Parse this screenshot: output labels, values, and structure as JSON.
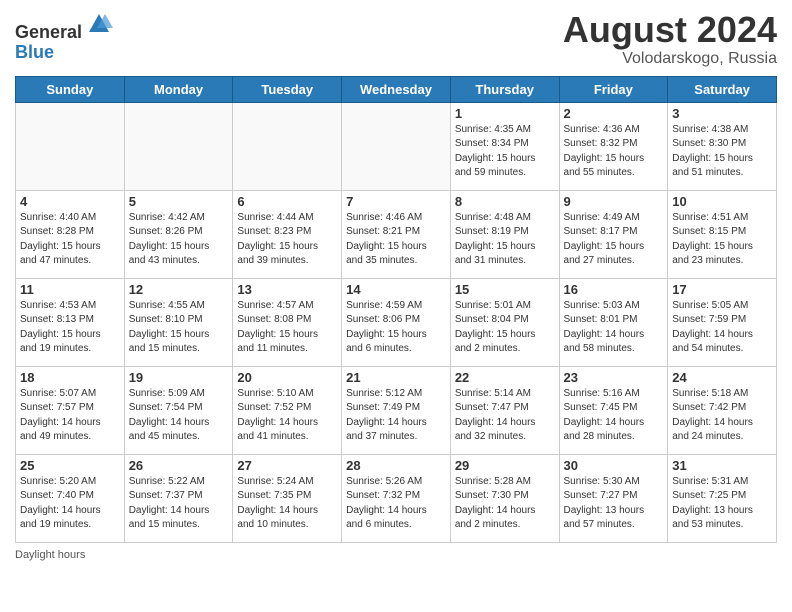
{
  "header": {
    "logo_general": "General",
    "logo_blue": "Blue",
    "month_title": "August 2024",
    "location": "Volodarskogo, Russia"
  },
  "footer": {
    "daylight_label": "Daylight hours"
  },
  "weekdays": [
    "Sunday",
    "Monday",
    "Tuesday",
    "Wednesday",
    "Thursday",
    "Friday",
    "Saturday"
  ],
  "weeks": [
    [
      {
        "day": "",
        "info": ""
      },
      {
        "day": "",
        "info": ""
      },
      {
        "day": "",
        "info": ""
      },
      {
        "day": "",
        "info": ""
      },
      {
        "day": "1",
        "info": "Sunrise: 4:35 AM\nSunset: 8:34 PM\nDaylight: 15 hours\nand 59 minutes."
      },
      {
        "day": "2",
        "info": "Sunrise: 4:36 AM\nSunset: 8:32 PM\nDaylight: 15 hours\nand 55 minutes."
      },
      {
        "day": "3",
        "info": "Sunrise: 4:38 AM\nSunset: 8:30 PM\nDaylight: 15 hours\nand 51 minutes."
      }
    ],
    [
      {
        "day": "4",
        "info": "Sunrise: 4:40 AM\nSunset: 8:28 PM\nDaylight: 15 hours\nand 47 minutes."
      },
      {
        "day": "5",
        "info": "Sunrise: 4:42 AM\nSunset: 8:26 PM\nDaylight: 15 hours\nand 43 minutes."
      },
      {
        "day": "6",
        "info": "Sunrise: 4:44 AM\nSunset: 8:23 PM\nDaylight: 15 hours\nand 39 minutes."
      },
      {
        "day": "7",
        "info": "Sunrise: 4:46 AM\nSunset: 8:21 PM\nDaylight: 15 hours\nand 35 minutes."
      },
      {
        "day": "8",
        "info": "Sunrise: 4:48 AM\nSunset: 8:19 PM\nDaylight: 15 hours\nand 31 minutes."
      },
      {
        "day": "9",
        "info": "Sunrise: 4:49 AM\nSunset: 8:17 PM\nDaylight: 15 hours\nand 27 minutes."
      },
      {
        "day": "10",
        "info": "Sunrise: 4:51 AM\nSunset: 8:15 PM\nDaylight: 15 hours\nand 23 minutes."
      }
    ],
    [
      {
        "day": "11",
        "info": "Sunrise: 4:53 AM\nSunset: 8:13 PM\nDaylight: 15 hours\nand 19 minutes."
      },
      {
        "day": "12",
        "info": "Sunrise: 4:55 AM\nSunset: 8:10 PM\nDaylight: 15 hours\nand 15 minutes."
      },
      {
        "day": "13",
        "info": "Sunrise: 4:57 AM\nSunset: 8:08 PM\nDaylight: 15 hours\nand 11 minutes."
      },
      {
        "day": "14",
        "info": "Sunrise: 4:59 AM\nSunset: 8:06 PM\nDaylight: 15 hours\nand 6 minutes."
      },
      {
        "day": "15",
        "info": "Sunrise: 5:01 AM\nSunset: 8:04 PM\nDaylight: 15 hours\nand 2 minutes."
      },
      {
        "day": "16",
        "info": "Sunrise: 5:03 AM\nSunset: 8:01 PM\nDaylight: 14 hours\nand 58 minutes."
      },
      {
        "day": "17",
        "info": "Sunrise: 5:05 AM\nSunset: 7:59 PM\nDaylight: 14 hours\nand 54 minutes."
      }
    ],
    [
      {
        "day": "18",
        "info": "Sunrise: 5:07 AM\nSunset: 7:57 PM\nDaylight: 14 hours\nand 49 minutes."
      },
      {
        "day": "19",
        "info": "Sunrise: 5:09 AM\nSunset: 7:54 PM\nDaylight: 14 hours\nand 45 minutes."
      },
      {
        "day": "20",
        "info": "Sunrise: 5:10 AM\nSunset: 7:52 PM\nDaylight: 14 hours\nand 41 minutes."
      },
      {
        "day": "21",
        "info": "Sunrise: 5:12 AM\nSunset: 7:49 PM\nDaylight: 14 hours\nand 37 minutes."
      },
      {
        "day": "22",
        "info": "Sunrise: 5:14 AM\nSunset: 7:47 PM\nDaylight: 14 hours\nand 32 minutes."
      },
      {
        "day": "23",
        "info": "Sunrise: 5:16 AM\nSunset: 7:45 PM\nDaylight: 14 hours\nand 28 minutes."
      },
      {
        "day": "24",
        "info": "Sunrise: 5:18 AM\nSunset: 7:42 PM\nDaylight: 14 hours\nand 24 minutes."
      }
    ],
    [
      {
        "day": "25",
        "info": "Sunrise: 5:20 AM\nSunset: 7:40 PM\nDaylight: 14 hours\nand 19 minutes."
      },
      {
        "day": "26",
        "info": "Sunrise: 5:22 AM\nSunset: 7:37 PM\nDaylight: 14 hours\nand 15 minutes."
      },
      {
        "day": "27",
        "info": "Sunrise: 5:24 AM\nSunset: 7:35 PM\nDaylight: 14 hours\nand 10 minutes."
      },
      {
        "day": "28",
        "info": "Sunrise: 5:26 AM\nSunset: 7:32 PM\nDaylight: 14 hours\nand 6 minutes."
      },
      {
        "day": "29",
        "info": "Sunrise: 5:28 AM\nSunset: 7:30 PM\nDaylight: 14 hours\nand 2 minutes."
      },
      {
        "day": "30",
        "info": "Sunrise: 5:30 AM\nSunset: 7:27 PM\nDaylight: 13 hours\nand 57 minutes."
      },
      {
        "day": "31",
        "info": "Sunrise: 5:31 AM\nSunset: 7:25 PM\nDaylight: 13 hours\nand 53 minutes."
      }
    ]
  ]
}
